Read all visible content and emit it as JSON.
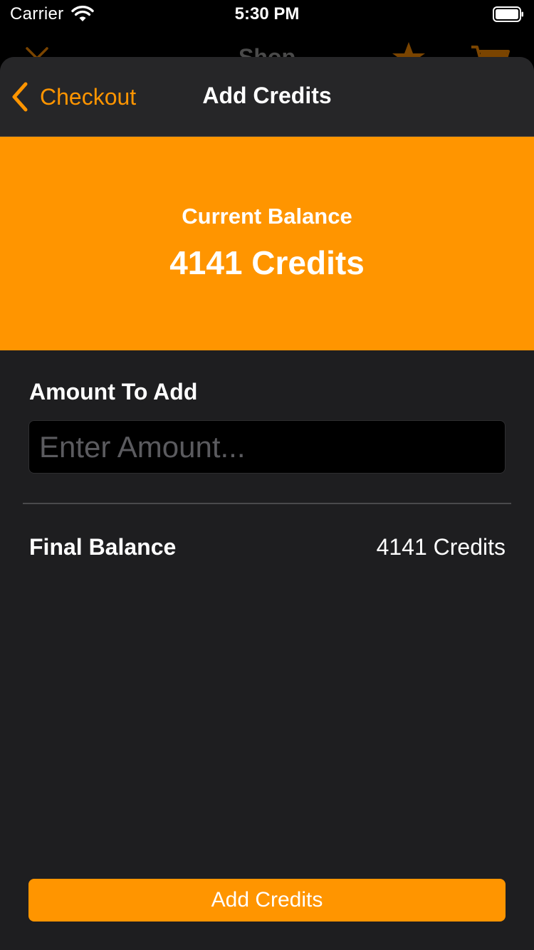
{
  "status_bar": {
    "carrier": "Carrier",
    "time": "5:30 PM",
    "icons": [
      "wifi-icon",
      "battery-icon"
    ]
  },
  "background_page": {
    "title": "Shop",
    "icons": [
      "close-icon",
      "star-icon",
      "cart-icon"
    ]
  },
  "nav": {
    "back_label": "Checkout",
    "back_icon": "chevron-left-icon",
    "title": "Add Credits"
  },
  "balance": {
    "caption": "Current Balance",
    "value": "4141 Credits"
  },
  "form": {
    "amount_label": "Amount To Add",
    "amount_value": "",
    "amount_placeholder": "Enter Amount..."
  },
  "summary": {
    "final_label": "Final Balance",
    "final_value": "4141 Credits"
  },
  "actions": {
    "add_label": "Add Credits"
  },
  "colors": {
    "accent": "#ff9500",
    "sheet_background": "#1e1e20",
    "nav_background": "#262628",
    "input_background": "#000000",
    "text": "#ffffff",
    "placeholder": "#5b5b5f"
  }
}
